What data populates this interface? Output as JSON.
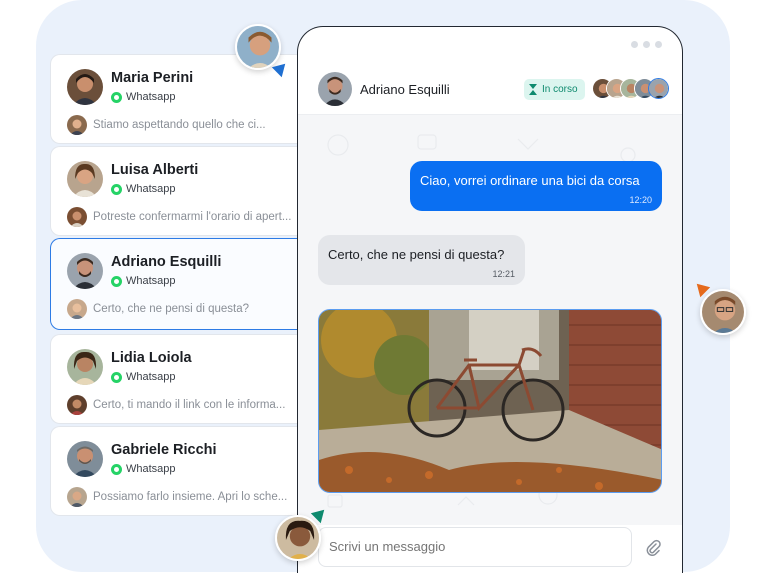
{
  "conversations": [
    {
      "name": "Maria Perini",
      "source": "Whatsapp",
      "preview": "Stiamo aspettando quello che ci...",
      "active": false
    },
    {
      "name": "Luisa Alberti",
      "source": "Whatsapp",
      "preview": "Potreste confermarmi l'orario di apert...",
      "active": false
    },
    {
      "name": "Adriano Esquilli",
      "source": "Whatsapp",
      "preview": "Certo, che ne pensi di questa?",
      "active": true
    },
    {
      "name": "Lidia Loiola",
      "source": "Whatsapp",
      "preview": "Certo, ti mando il link con le informa...",
      "active": false
    },
    {
      "name": "Gabriele Ricchi",
      "source": "Whatsapp",
      "preview": "Possiamo farlo insieme. Apri lo sche...",
      "active": false
    }
  ],
  "chat": {
    "contact_name": "Adriano Esquilli",
    "status": "In corso",
    "messages": [
      {
        "direction": "outgoing",
        "text": "Ciao, vorrei ordinare una bici da corsa",
        "time": "12:20"
      },
      {
        "direction": "incoming",
        "text": "Certo, che ne pensi di questa?",
        "time": "12:21"
      }
    ],
    "composer_placeholder": "Scrivi un messaggio"
  },
  "colors": {
    "accent": "#0a6ff2",
    "active_border": "#2d7be5",
    "status_bg": "#dcf5ef",
    "status_text": "#0e8a6e",
    "whatsapp": "#25d366",
    "page_bg": "#eaf1fb"
  },
  "icons": [
    "whatsapp-icon",
    "hourglass-icon",
    "paperclip-icon",
    "window-dots-icon"
  ]
}
